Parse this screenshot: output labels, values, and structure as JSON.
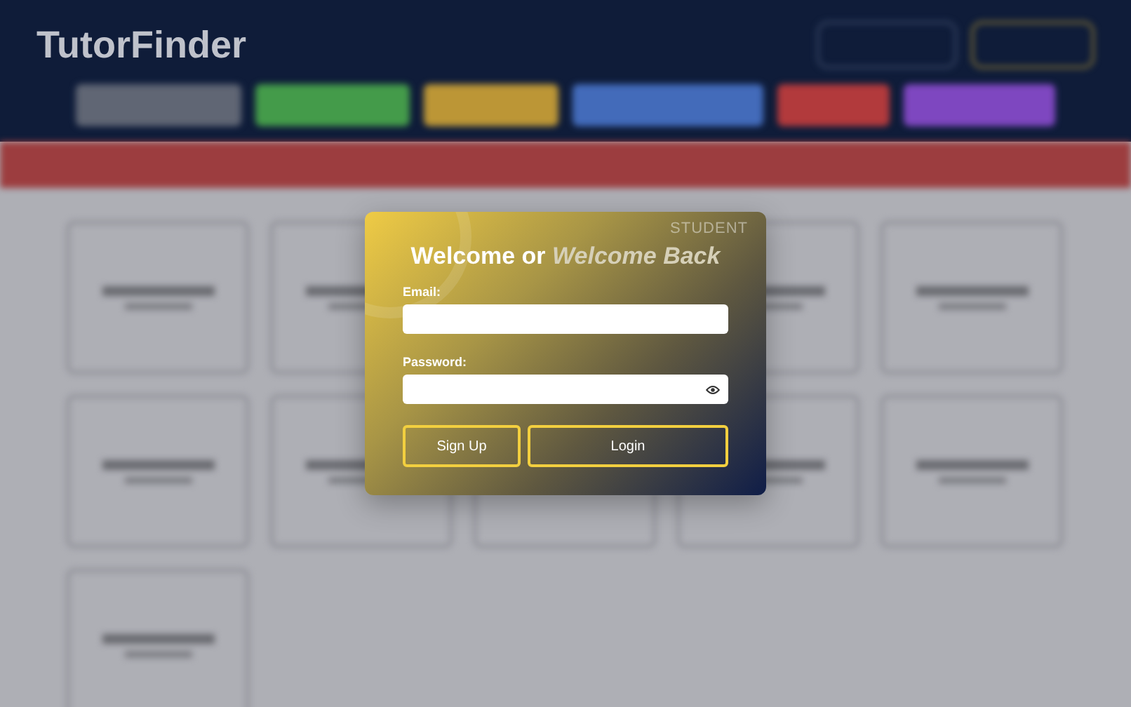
{
  "header": {
    "logo": "TutorFinder"
  },
  "modal": {
    "role_badge": "STUDENT",
    "title": "Welcome or *Welcome Back*",
    "fields": [
      {
        "kind": "text",
        "label": "Email:"
      },
      {
        "kind": "password",
        "label": "Password:"
      }
    ],
    "buttons": [
      {
        "label": "Sign Up",
        "kind": "secondary"
      },
      {
        "label": "Login",
        "kind": "primary"
      }
    ]
  }
}
